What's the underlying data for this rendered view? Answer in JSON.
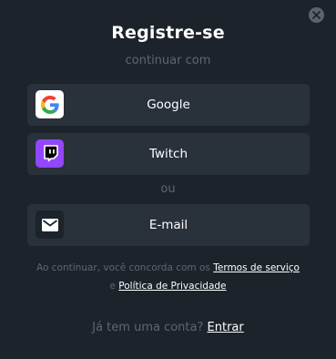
{
  "modal": {
    "title": "Registre-se",
    "subtitle": "continuar com",
    "divider_text": "ou"
  },
  "providers": [
    {
      "label": "Google",
      "icon": "google-icon",
      "icon_bg": "#ffffff"
    },
    {
      "label": "Twitch",
      "icon": "twitch-icon",
      "icon_bg": "#9146ff"
    },
    {
      "label": "E-mail",
      "icon": "mail-icon",
      "icon_bg": "#1c232b"
    }
  ],
  "terms": {
    "prefix": "Ao continuar, você concorda com os",
    "terms_link": "Termos de serviço",
    "conjunction": "e",
    "privacy_link": "Política de Privacidade"
  },
  "login": {
    "prompt": "Já tem uma conta?",
    "link": "Entrar"
  },
  "colors": {
    "background": "#1c232b",
    "button": "#29313a",
    "muted_text": "#5d6772",
    "text": "#ffffff",
    "twitch": "#9146ff"
  }
}
